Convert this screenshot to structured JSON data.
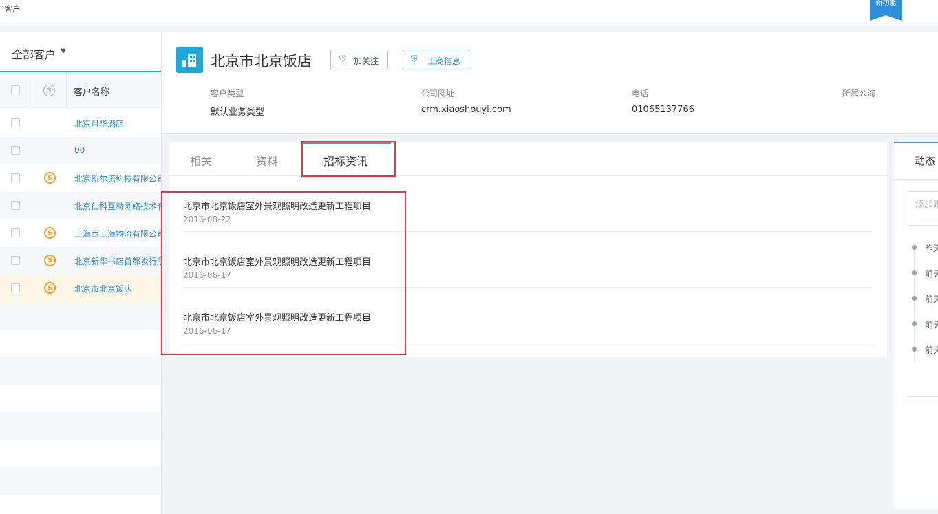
{
  "topbar": {
    "title": "客户",
    "ribbon_label": "新功能"
  },
  "sidebar": {
    "filter_label": "全部客户",
    "column_header": "客户名称",
    "rows": [
      {
        "name": "北京月华酒店",
        "paid": false
      },
      {
        "name": "00",
        "paid": false
      },
      {
        "name": "北京斯尔诺科技有限公司",
        "paid": true
      },
      {
        "name": "北京仁科互动网络技术有限公司",
        "paid": false
      },
      {
        "name": "上海西上海物流有限公司",
        "paid": true
      },
      {
        "name": "北京新华书店首都发行所",
        "paid": true
      },
      {
        "name": "北京市北京饭店",
        "paid": true,
        "selected": true
      }
    ]
  },
  "header": {
    "company_name": "北京市北京饭店",
    "follow_button": "加关注",
    "business_info_button": "工商信息",
    "fields": [
      {
        "label": "客户类型",
        "value": "默认业务类型"
      },
      {
        "label": "公司网址",
        "value": "crm.xiaoshouyi.com"
      },
      {
        "label": "电话",
        "value": "01065137766"
      },
      {
        "label": "所属公海",
        "value": ""
      }
    ]
  },
  "tabs": [
    {
      "label": "相关",
      "active": false
    },
    {
      "label": "资料",
      "active": false
    },
    {
      "label": "招标资讯",
      "active": true
    }
  ],
  "tender_items": [
    {
      "title": "北京市北京饭店室外景观照明改造更新工程项目",
      "date": "2016-08-22"
    },
    {
      "title": "北京市北京饭店室外景观照明改造更新工程项目",
      "date": "2016-06-17"
    },
    {
      "title": "北京市北京饭店室外景观照明改造更新工程项目",
      "date": "2016-06-17"
    }
  ],
  "activity": {
    "title": "动态",
    "input_placeholder": "添加跟进",
    "timeline": [
      "昨天",
      "前天",
      "前天",
      "前天",
      "前天"
    ]
  },
  "colors": {
    "accent": "#2aa4d5",
    "link": "#2a8fd0",
    "highlight_box": "#e0383e",
    "paid_icon": "#f0a01c"
  }
}
